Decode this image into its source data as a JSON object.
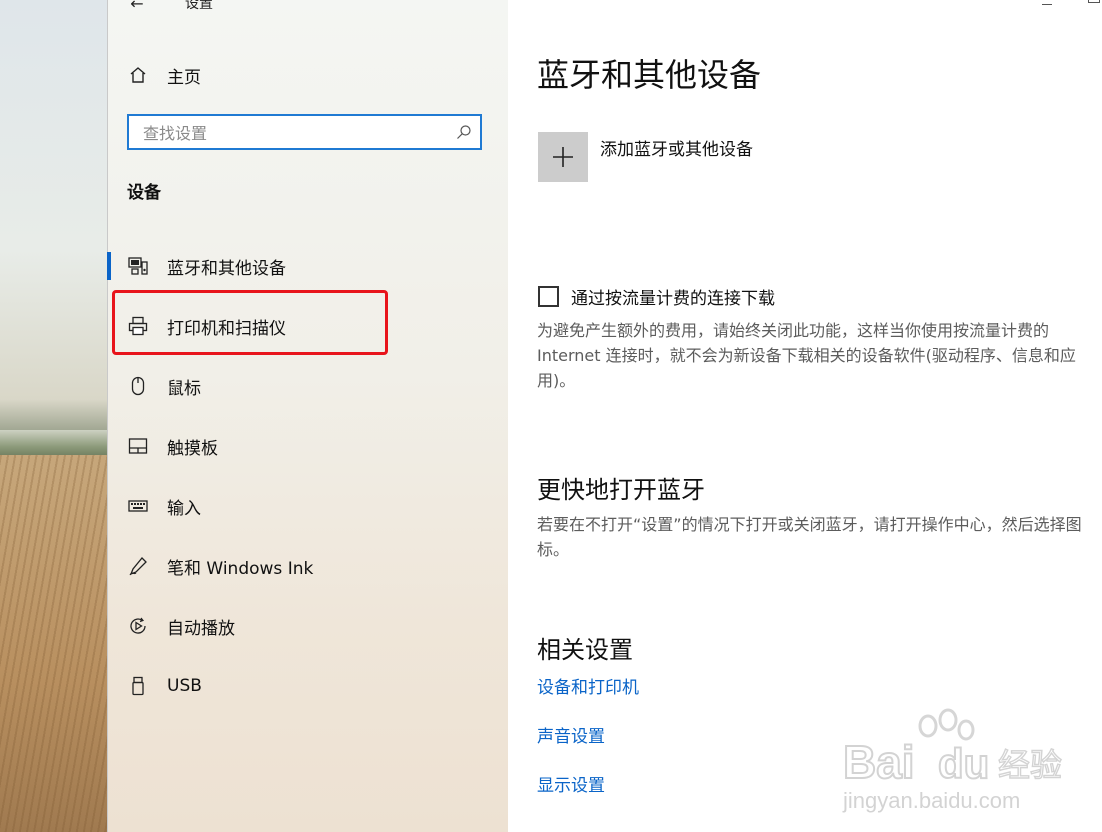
{
  "window": {
    "title": "设置",
    "back_label": "←"
  },
  "sidebar": {
    "home_label": "主页",
    "search_placeholder": "查找设置",
    "section_label": "设备",
    "items": [
      {
        "label": "蓝牙和其他设备",
        "icon": "bluetooth-devices-icon",
        "selected": true
      },
      {
        "label": "打印机和扫描仪",
        "icon": "printer-icon",
        "selected": false
      },
      {
        "label": "鼠标",
        "icon": "mouse-icon",
        "selected": false
      },
      {
        "label": "触摸板",
        "icon": "touchpad-icon",
        "selected": false
      },
      {
        "label": "输入",
        "icon": "keyboard-icon",
        "selected": false
      },
      {
        "label": "笔和 Windows Ink",
        "icon": "pen-icon",
        "selected": false
      },
      {
        "label": "自动播放",
        "icon": "autoplay-icon",
        "selected": false
      },
      {
        "label": "USB",
        "icon": "usb-icon",
        "selected": false
      }
    ]
  },
  "main": {
    "title": "蓝牙和其他设备",
    "add_device_label": "添加蓝牙或其他设备",
    "metered": {
      "label": "通过按流量计费的连接下载",
      "checked": false,
      "description": "为避免产生额外的费用，请始终关闭此功能，这样当你使用按流量计费的 Internet 连接时，就不会为新设备下载相关的设备软件(驱动程序、信息和应用)。"
    },
    "quick_bluetooth": {
      "title": "更快地打开蓝牙",
      "description": "若要在不打开“设置”的情况下打开或关闭蓝牙，请打开操作中心，然后选择图标。"
    },
    "related": {
      "title": "相关设置",
      "links": [
        "设备和打印机",
        "声音设置",
        "显示设置"
      ]
    }
  },
  "watermark": {
    "brand": "Bai",
    "brand_cn": "经验",
    "url": "jingyan.baidu.com"
  },
  "colors": {
    "accent": "#0a64c8",
    "highlight": "#e8141b",
    "search_border": "#1f7ad3"
  }
}
